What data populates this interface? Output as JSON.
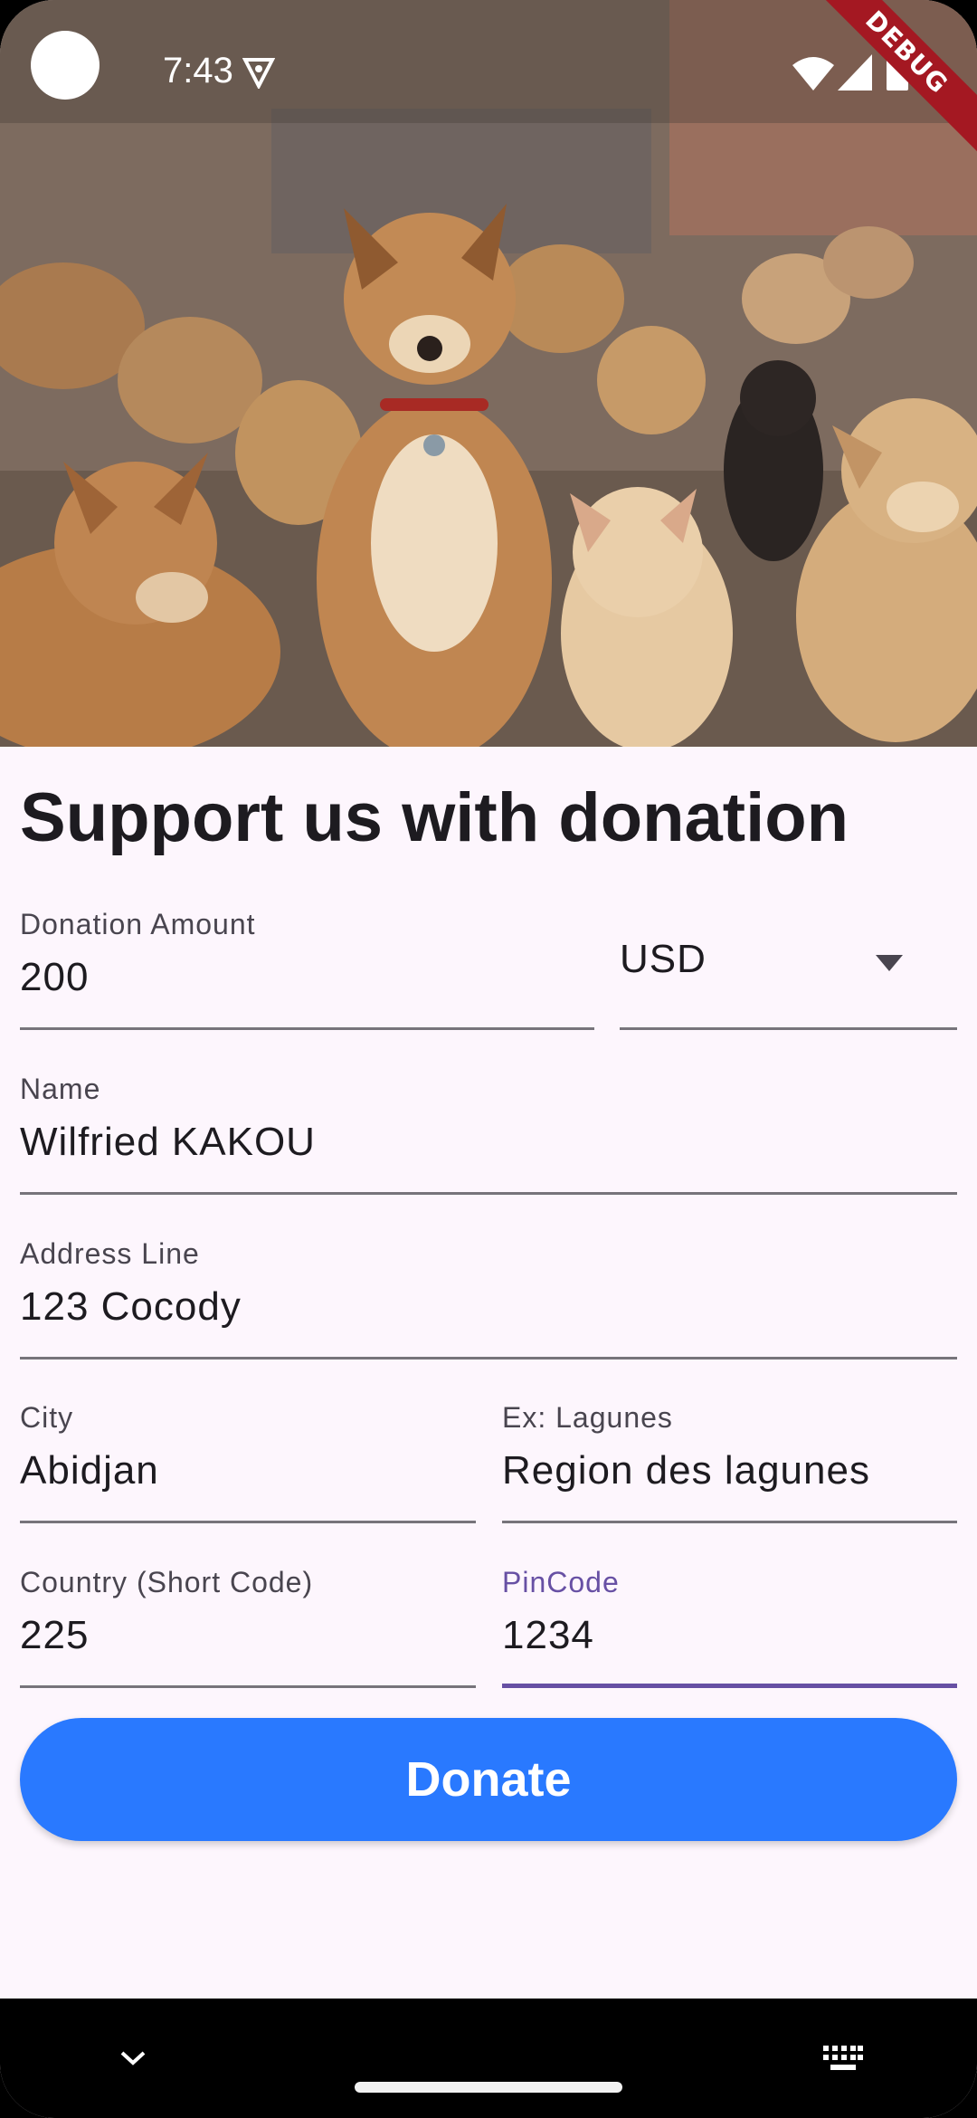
{
  "status_bar": {
    "time": "7:43",
    "debug_label": "DEBUG"
  },
  "form": {
    "title": "Support us with donation",
    "donation_amount": {
      "label": "Donation Amount",
      "value": "200"
    },
    "currency": {
      "value": "USD"
    },
    "name": {
      "label": "Name",
      "value": "Wilfried KAKOU"
    },
    "address": {
      "label": "Address Line",
      "value": "123 Cocody"
    },
    "city": {
      "label": "City",
      "value": "Abidjan"
    },
    "region": {
      "label": "Ex: Lagunes",
      "value": "Region des lagunes"
    },
    "country": {
      "label": "Country (Short Code)",
      "value": "225"
    },
    "pincode": {
      "label": "PinCode",
      "value": "1234",
      "focused": true
    },
    "donate_button": "Donate"
  },
  "colors": {
    "accent": "#6750a4",
    "button": "#2979ff",
    "background": "#fdf6fd",
    "debug_banner": "#a41822"
  },
  "icons": [
    "vpn-key-icon",
    "wifi-icon",
    "cell-signal-icon",
    "battery-icon",
    "dropdown-arrow-icon",
    "nav-chevron-down-icon",
    "keyboard-icon"
  ]
}
